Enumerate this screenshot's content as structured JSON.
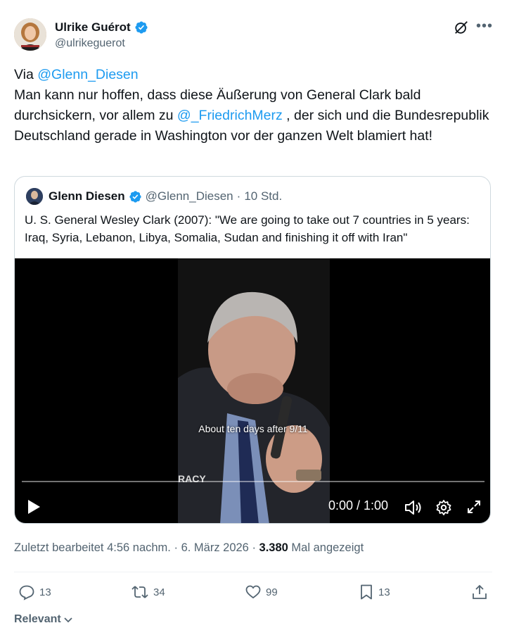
{
  "author": {
    "name": "Ulrike Guérot",
    "handle": "@ulrikeguerot"
  },
  "tweet": {
    "line1_prefix": "Via ",
    "mention1": "@Glenn_Diesen",
    "line2": "Man kann nur hoffen, dass diese Äußerung von General Clark bald durchsickern, vor allem zu ",
    "mention2": "@_FriedrichMerz",
    "line3": " , der sich und die Bundesrepublik Deutschland gerade in Washington vor der ganzen Welt blamiert hat!"
  },
  "quote": {
    "name": "Glenn Diesen",
    "handle": "@Glenn_Diesen",
    "dot": "·",
    "time": "10 Std.",
    "text": "U. S. General Wesley Clark (2007): \"We are going to take out 7 countries in 5 years: Iraq, Syria, Lebanon, Libya, Somalia, Sudan and finishing it off with Iran\"",
    "video": {
      "caption": "About ten days after 9/11",
      "time": "0:00 / 1:00",
      "progress": 0
    }
  },
  "meta": {
    "edited": "Zuletzt bearbeitet 4:56 nachm.",
    "dot1": " · ",
    "date": "6. März 2026",
    "dot2": " · ",
    "views_count": "3.380",
    "views_label": " Mal angezeigt"
  },
  "actions": {
    "replies": "13",
    "reposts": "34",
    "likes": "99",
    "bookmarks": "13"
  },
  "sort": {
    "label": "Relevant"
  },
  "colors": {
    "link": "#1d9bf0",
    "text": "#0f1419",
    "muted": "#536471",
    "border": "#cfd9de"
  }
}
